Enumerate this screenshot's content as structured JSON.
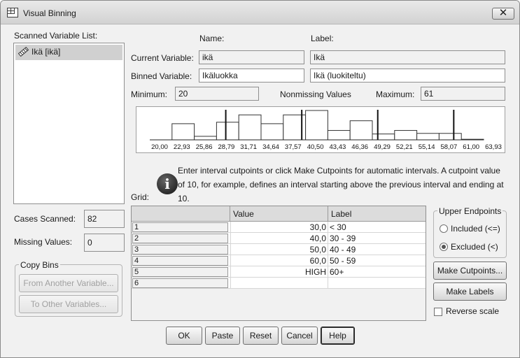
{
  "window": {
    "title": "Visual Binning",
    "close_label": "✕"
  },
  "scanned_list": {
    "label": "Scanned Variable List:",
    "items": [
      {
        "label": "Ikä [ikä]"
      }
    ]
  },
  "headers": {
    "name": "Name:",
    "label": "Label:"
  },
  "current_variable": {
    "label": "Current Variable:",
    "name": "ikä",
    "var_label": "Ikä"
  },
  "binned_variable": {
    "label": "Binned Variable:",
    "name": "Ikäluokka",
    "var_label": "Ikä (luokiteltu)"
  },
  "minimum": {
    "label": "Minimum:",
    "value": "20"
  },
  "nonmissing": {
    "label": "Nonmissing Values"
  },
  "maximum": {
    "label": "Maximum:",
    "value": "61"
  },
  "histogram": {
    "tick_labels": [
      "20,00",
      "22,93",
      "25,86",
      "28,79",
      "31,71",
      "34,64",
      "37,57",
      "40,50",
      "43,43",
      "46,36",
      "49,29",
      "52,21",
      "55,14",
      "58,07",
      "61,00",
      "63,93"
    ],
    "bar_heights": [
      0.0,
      0.55,
      0.12,
      0.6,
      0.85,
      0.55,
      0.85,
      1.0,
      0.32,
      0.65,
      0.2,
      0.32,
      0.22,
      0.22,
      0.02
    ],
    "cutpoints": [
      30,
      40,
      50,
      60
    ]
  },
  "info": {
    "text": "Enter interval cutpoints or click Make Cutpoints for automatic intervals. A cutpoint value of 10, for example, defines an interval starting above the previous interval and ending at 10."
  },
  "grid": {
    "label": "Grid:",
    "col_value": "Value",
    "col_label": "Label",
    "rows": [
      {
        "num": "1",
        "value": "30,0",
        "label": "< 30"
      },
      {
        "num": "2",
        "value": "40,0",
        "label": "30 - 39"
      },
      {
        "num": "3",
        "value": "50,0",
        "label": "40 - 49"
      },
      {
        "num": "4",
        "value": "60,0",
        "label": "50 - 59"
      },
      {
        "num": "5",
        "value": "HIGH",
        "label": "60+"
      },
      {
        "num": "6",
        "value": "",
        "label": ""
      }
    ]
  },
  "cases_scanned": {
    "label": "Cases Scanned:",
    "value": "82"
  },
  "missing_values": {
    "label": "Missing Values:",
    "value": "0"
  },
  "copy_bins": {
    "title": "Copy Bins",
    "from_button": "From Another Variable...",
    "to_button": "To Other Variables..."
  },
  "upper_endpoints": {
    "title": "Upper Endpoints",
    "included": "Included (<=)",
    "excluded": "Excluded (<)",
    "selected": "excluded"
  },
  "make_cutpoints_button": "Make Cutpoints...",
  "make_labels_button": "Make Labels",
  "reverse_scale": {
    "label": "Reverse scale",
    "checked": false
  },
  "buttons": {
    "ok": "OK",
    "paste": "Paste",
    "reset": "Reset",
    "cancel": "Cancel",
    "help": "Help"
  }
}
